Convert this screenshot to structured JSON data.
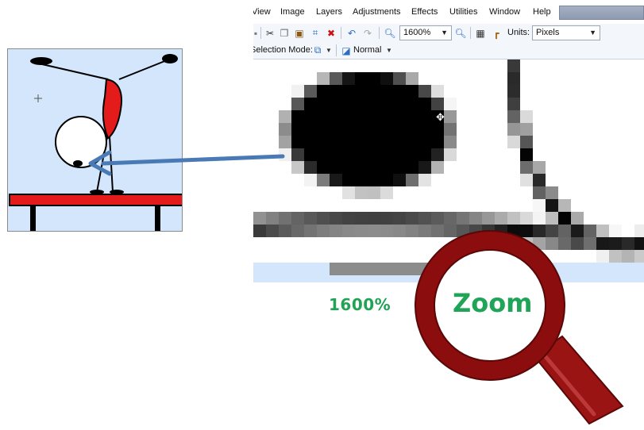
{
  "menu": [
    "View",
    "Image",
    "Layers",
    "Adjustments",
    "Effects",
    "Utilities",
    "Window",
    "Help"
  ],
  "toolbar": {
    "zoom_value": "1600%",
    "units_label": "Units:",
    "units_value": "Pixels",
    "selection_mode_label": "Selection Mode:",
    "blend_mode_value": "Normal"
  },
  "overlay": {
    "zoom_percent": "1600%",
    "zoom_word": "Zoom"
  },
  "colors": {
    "label_green": "#21a356",
    "magnifier_red": "#8b0d0d",
    "arrow_blue": "#4a7ab5",
    "figure_red": "#e31b1b",
    "sky_blue": "#d3e6fb"
  }
}
